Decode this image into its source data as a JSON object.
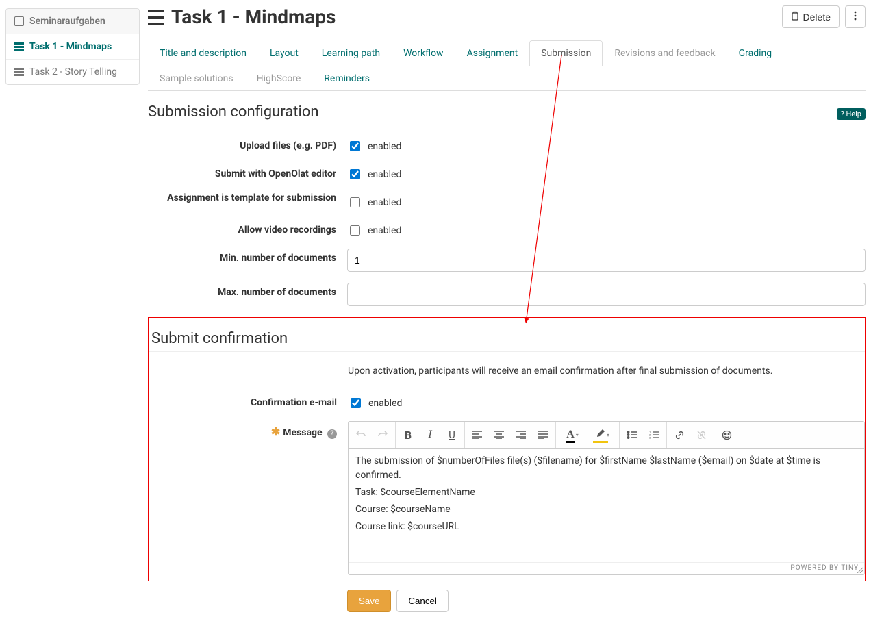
{
  "sidebar": {
    "header": "Seminaraufgaben",
    "items": [
      {
        "label": "Task 1 - Mindmaps",
        "active": true
      },
      {
        "label": "Task 2 - Story Telling",
        "active": false
      }
    ]
  },
  "header": {
    "title": "Task 1 - Mindmaps",
    "delete": "Delete"
  },
  "tabs": [
    {
      "k": "title_desc",
      "label": "Title and description"
    },
    {
      "k": "layout",
      "label": "Layout"
    },
    {
      "k": "learning_path",
      "label": "Learning path"
    },
    {
      "k": "workflow",
      "label": "Workflow"
    },
    {
      "k": "assignment",
      "label": "Assignment"
    },
    {
      "k": "submission",
      "label": "Submission",
      "active": true
    },
    {
      "k": "revisions",
      "label": "Revisions and feedback",
      "disabled": true
    },
    {
      "k": "grading",
      "label": "Grading"
    },
    {
      "k": "sample",
      "label": "Sample solutions",
      "disabled": true
    },
    {
      "k": "highscore",
      "label": "HighScore",
      "disabled": true
    },
    {
      "k": "reminders",
      "label": "Reminders"
    }
  ],
  "section1": {
    "title": "Submission configuration",
    "help": "Help",
    "upload_label": "Upload files (e.g. PDF)",
    "editor_label": "Submit with OpenOlat editor",
    "template_label": "Assignment is template for submission",
    "video_label": "Allow video recordings",
    "min_docs_label": "Min. number of documents",
    "max_docs_label": "Max. number of documents",
    "enabled": "enabled",
    "min_value": "1",
    "max_value": ""
  },
  "section2": {
    "title": "Submit confirmation",
    "description": "Upon activation, participants will receive an email confirmation after final submission of documents.",
    "confirm_label": "Confirmation e-mail",
    "enabled": "enabled",
    "message_label": "Message",
    "body_line1": "The submission of $numberOfFiles file(s) ($filename) for $firstName $lastName ($email) on $date at $time is confirmed.",
    "body_line2": "Task: $courseElementName",
    "body_line3": "Course: $courseName",
    "body_line4": "Course link: $courseURL",
    "powered": "POWERED BY TINY"
  },
  "footer": {
    "save": "Save",
    "cancel": "Cancel"
  }
}
